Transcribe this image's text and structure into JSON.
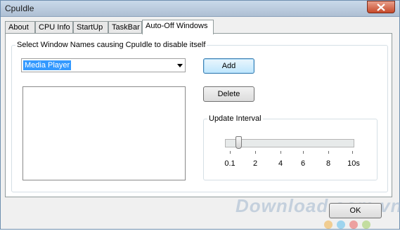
{
  "window": {
    "title": "CpuIdle"
  },
  "tabs": [
    {
      "label": "About"
    },
    {
      "label": "CPU Info"
    },
    {
      "label": "StartUp"
    },
    {
      "label": "TaskBar"
    },
    {
      "label": "Auto-Off Windows",
      "active": true
    }
  ],
  "group_windows": {
    "legend": "Select Window Names causing CpuIdle to disable itself"
  },
  "combo": {
    "value": "Media Player"
  },
  "buttons": {
    "add": "Add",
    "delete": "Delete",
    "ok": "OK"
  },
  "update_interval": {
    "legend": "Update Interval",
    "tick_labels": [
      "0.1",
      "2",
      "4",
      "6",
      "8",
      "10s"
    ]
  },
  "watermark": {
    "text": "Download.com.vn"
  },
  "colors": {
    "selection": "#3399ff",
    "watermark_dots": [
      "#f2a21c",
      "#3ab2ec",
      "#e83e3e",
      "#8cc63f",
      "#f2a21c"
    ]
  }
}
